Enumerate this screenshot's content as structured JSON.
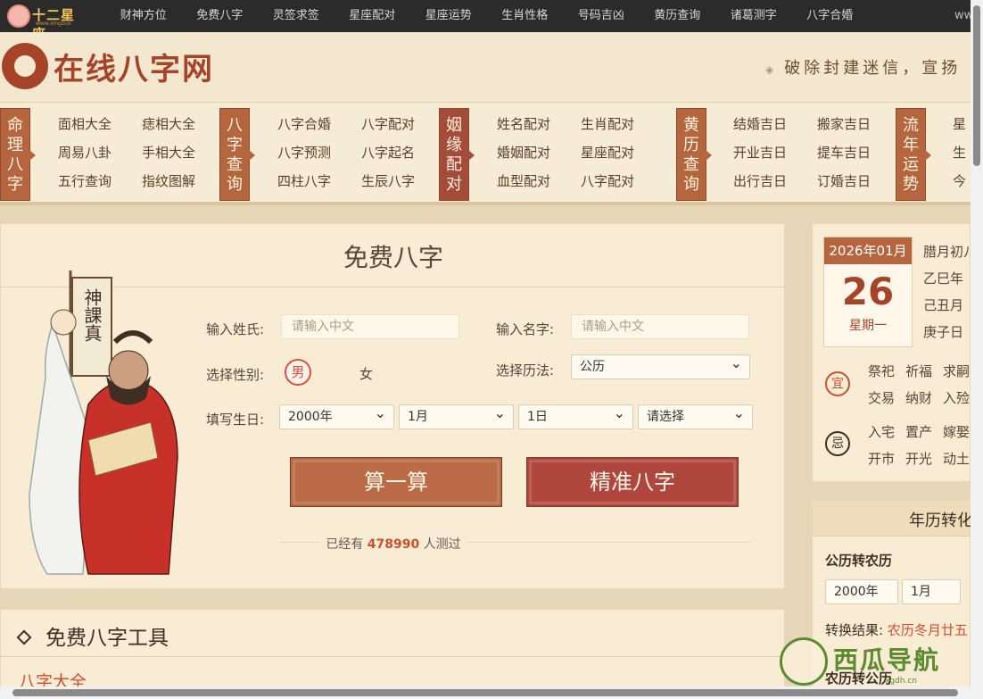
{
  "colors": {
    "brand": "#a6442a",
    "accent": "#b5663f",
    "accent2": "#b0473f",
    "page_bg": "#e6d6b8",
    "panel_bg": "#f8ecd4",
    "topbar": "#2b2b2b"
  },
  "topbar": {
    "logo_text": "十二星座",
    "logo_sub": "www.xingzuo",
    "nav": [
      "财神方位",
      "免费八字",
      "灵签求签",
      "星座配对",
      "星座运势",
      "生肖性格",
      "号码吉凶",
      "黄历查询",
      "诸葛测字",
      "八字合婚"
    ],
    "right_text": "www"
  },
  "header": {
    "brand_name": "在线八字网",
    "slogan": "破除封建迷信，宣扬",
    "emblem_icon": "knot-emblem-icon"
  },
  "catnav": {
    "groups": [
      {
        "title": "命理八字",
        "links": [
          "面相大全",
          "痣相大全",
          "周易八卦",
          "手相大全",
          "五行查询",
          "指纹图解"
        ]
      },
      {
        "title": "八字查询",
        "links": [
          "八字合婚",
          "八字配对",
          "八字预测",
          "八字起名",
          "四柱八字",
          "生辰八字"
        ]
      },
      {
        "title": "姻缘配对",
        "links": [
          "姓名配对",
          "生肖配对",
          "婚姻配对",
          "星座配对",
          "血型配对",
          "八字配对"
        ]
      },
      {
        "title": "黄历查询",
        "links": [
          "结婚吉日",
          "搬家吉日",
          "开业吉日",
          "提车吉日",
          "出行吉日",
          "订婚吉日"
        ]
      },
      {
        "title": "流年运势",
        "links": [
          "星",
          "生",
          "今"
        ]
      }
    ]
  },
  "main": {
    "title": "免费八字",
    "surname_label": "输入姓氏:",
    "surname_placeholder": "请输入中文",
    "name_label": "输入名字:",
    "name_placeholder": "请输入中文",
    "gender_label": "选择性别:",
    "gender_male": "男",
    "gender_female": "女",
    "calendar_label": "选择历法:",
    "calendar_value": "公历",
    "birth_label": "填写生日:",
    "birth_year": "2000年",
    "birth_month": "1月",
    "birth_day": "1日",
    "birth_hour": "请选择",
    "btn_calc": "算一算",
    "btn_precise": "精准八字",
    "count_prefix": "已经有",
    "count_value": "478990",
    "count_suffix": "人测过",
    "figure_banner_text": "神課真"
  },
  "tools": {
    "title": "免费八字工具",
    "sub": "八字大全"
  },
  "calendar": {
    "year_month": "2026年01月",
    "day": "26",
    "weekday": "星期一",
    "lunar": [
      "腊月初八",
      "乙巳年",
      "己丑月",
      "庚子日"
    ],
    "yi_icon": "宜",
    "yi": [
      "祭祀",
      "祈福",
      "求嗣",
      "交易",
      "纳财",
      "入殓"
    ],
    "ji_icon": "忌",
    "ji": [
      "入宅",
      "置产",
      "嫁娶",
      "开市",
      "开光",
      "动土"
    ]
  },
  "converter": {
    "title": "年历转化",
    "subtitle": "公历转农历",
    "year": "2000年",
    "month": "1月",
    "result_label": "转换结果:",
    "result_value": "农历冬月廿五",
    "subtitle2": "农历转公历"
  },
  "watermark": {
    "text": "西瓜导航",
    "url": "xgdh.cn"
  }
}
